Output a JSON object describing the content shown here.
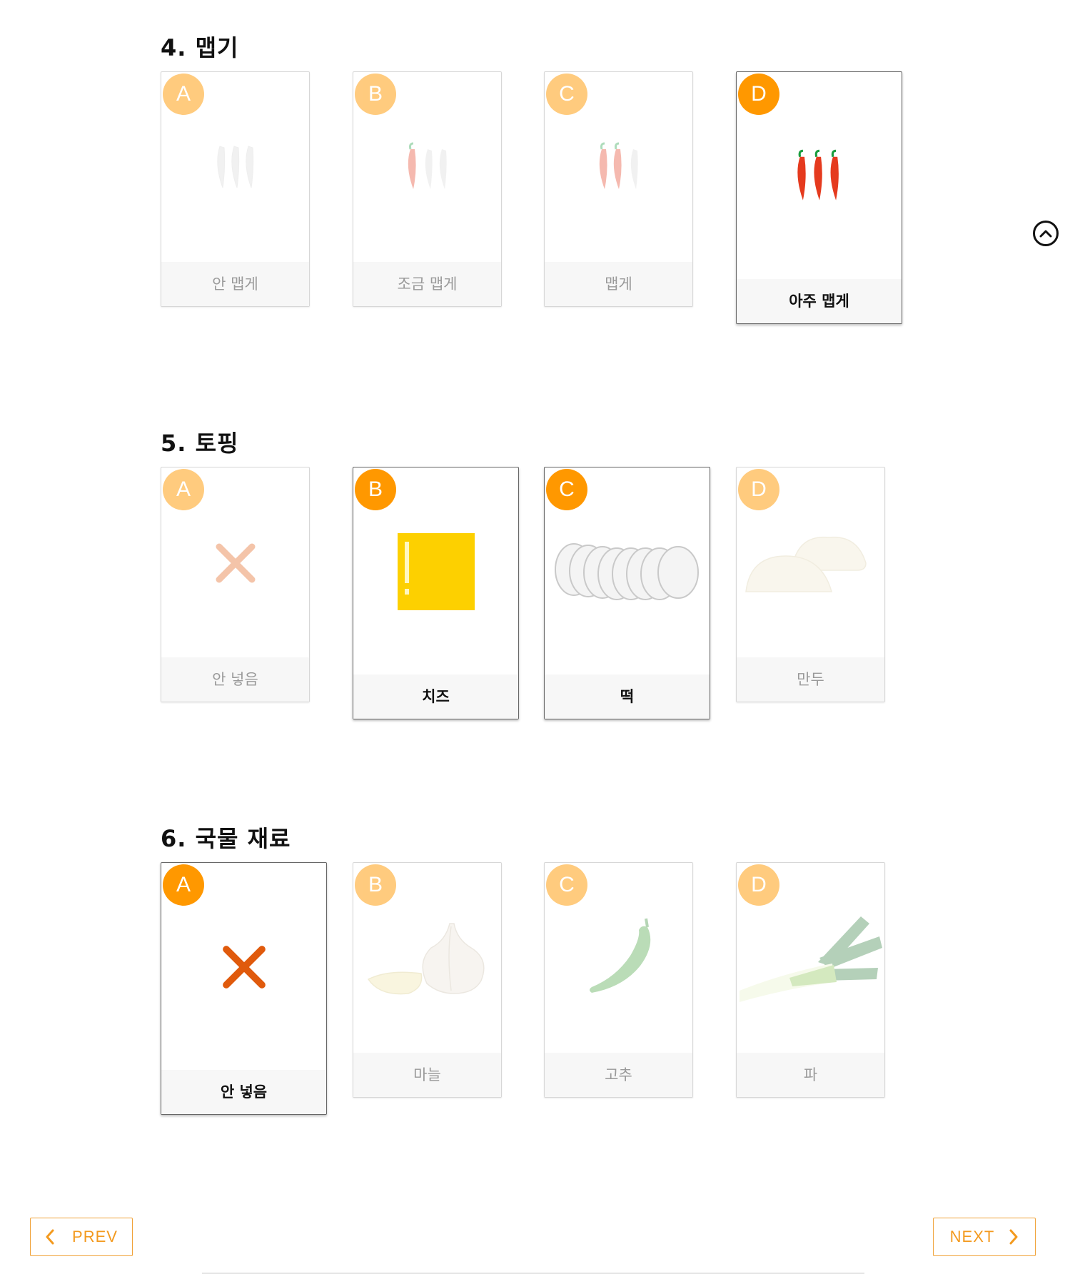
{
  "sections": [
    {
      "title": "4. 맵기",
      "options": [
        {
          "letter": "A",
          "label": "안 맵게",
          "icon": "white-peppers-icon",
          "selected": false
        },
        {
          "letter": "B",
          "label": "조금 맵게",
          "icon": "one-red-pepper-icon",
          "selected": false
        },
        {
          "letter": "C",
          "label": "맵게",
          "icon": "two-red-peppers-icon",
          "selected": false
        },
        {
          "letter": "D",
          "label": "아주 맵게",
          "icon": "three-red-peppers-icon",
          "selected": true
        }
      ]
    },
    {
      "title": "5. 토핑",
      "options": [
        {
          "letter": "A",
          "label": "안 넣음",
          "icon": "x-mark-icon",
          "selected": false
        },
        {
          "letter": "B",
          "label": "치즈",
          "icon": "cheese-icon",
          "selected": true
        },
        {
          "letter": "C",
          "label": "떡",
          "icon": "rice-cake-icon",
          "selected": true
        },
        {
          "letter": "D",
          "label": "만두",
          "icon": "dumpling-icon",
          "selected": false
        }
      ]
    },
    {
      "title": "6. 국물 재료",
      "options": [
        {
          "letter": "A",
          "label": "안 넣음",
          "icon": "x-mark-icon",
          "selected": true
        },
        {
          "letter": "B",
          "label": "마늘",
          "icon": "garlic-icon",
          "selected": false
        },
        {
          "letter": "C",
          "label": "고추",
          "icon": "green-pepper-icon",
          "selected": false
        },
        {
          "letter": "D",
          "label": "파",
          "icon": "green-onion-icon",
          "selected": false
        }
      ]
    }
  ],
  "nav": {
    "prev_label": "PREV",
    "next_label": "NEXT"
  },
  "colors": {
    "accent": "#ff9800",
    "nav_text": "#f39a1f"
  }
}
